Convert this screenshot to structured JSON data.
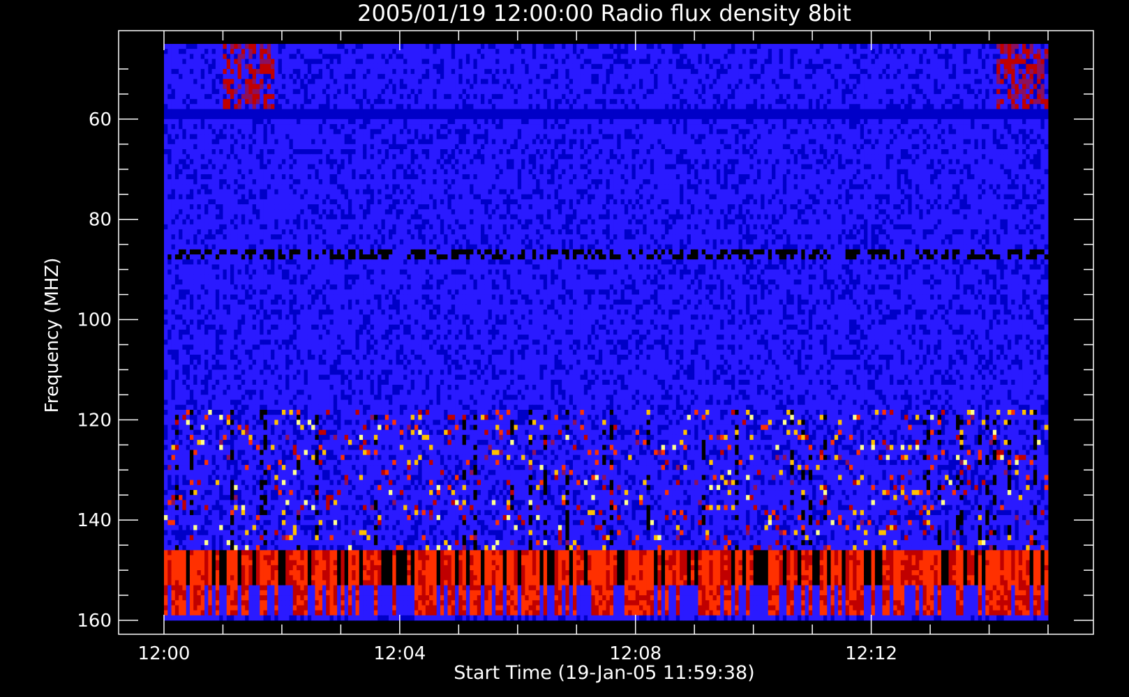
{
  "chart_data": {
    "type": "heatmap",
    "title": "2005/01/19 12:00:00 Radio flux density 8bit",
    "xlabel": "Start Time (19-Jan-05 11:59:38)",
    "ylabel": "Frequency (MHZ)",
    "x_ticks": [
      "12:00",
      "12:04",
      "12:08",
      "12:12"
    ],
    "x_tick_minutes": [
      0,
      4,
      8,
      12
    ],
    "xlim_minutes": [
      0,
      15
    ],
    "y_ticks": [
      "60",
      "80",
      "100",
      "120",
      "140",
      "160"
    ],
    "y_tick_values": [
      60,
      80,
      100,
      120,
      140,
      160
    ],
    "ylim_mhz": [
      45,
      160
    ],
    "y_inverted": true,
    "colormap": [
      "#000000",
      "#0000c8",
      "#2a1aff",
      "#8a1060",
      "#c00000",
      "#ff3000",
      "#ffc000",
      "#ffff90"
    ],
    "background_color": "#000000",
    "axis_color": "#ffffff"
  }
}
